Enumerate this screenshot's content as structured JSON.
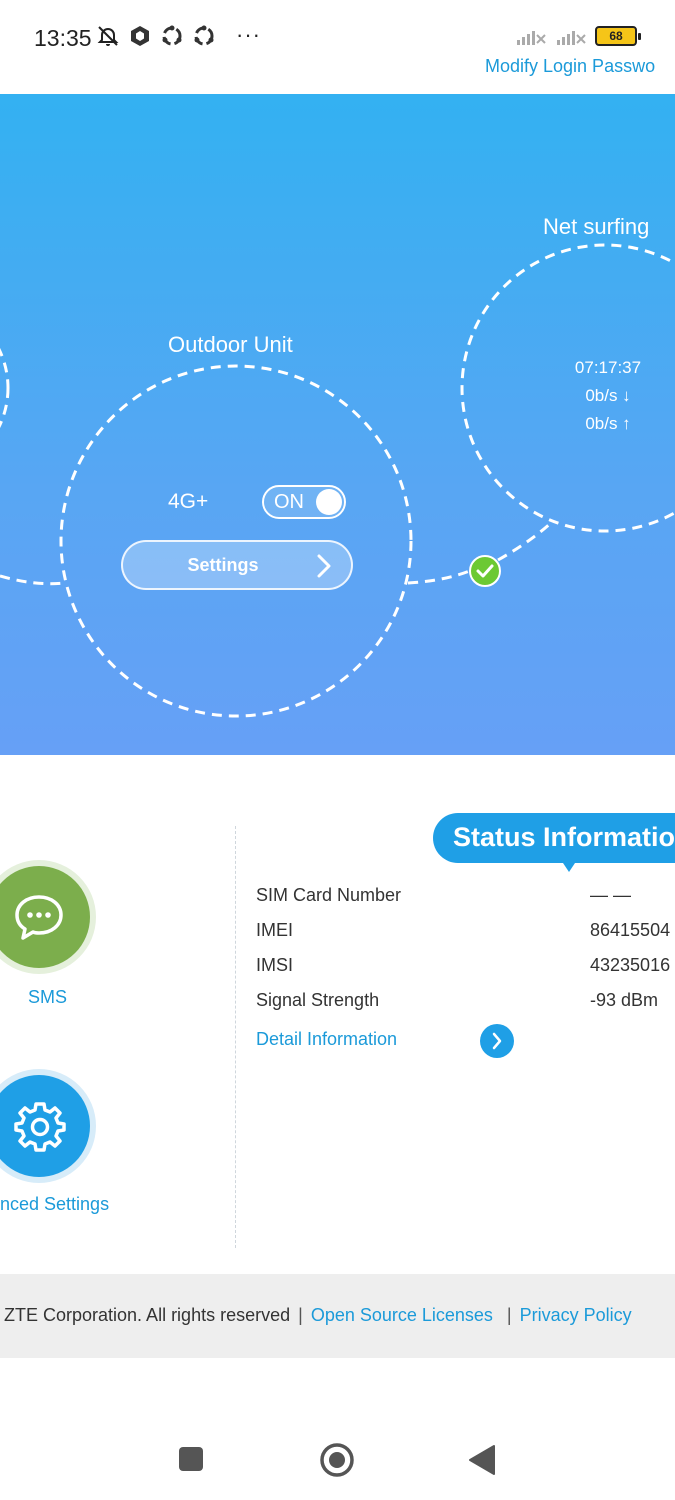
{
  "statusbar": {
    "time": "13:35",
    "battery": "68"
  },
  "header": {
    "modify_login_password": "Modify Login Passwo"
  },
  "hero": {
    "net_surfing_label": "Net surfing",
    "net_duration": "07:17:37",
    "download_rate": "0b/s ↓",
    "upload_rate": "0b/s ↑",
    "outdoor_unit_label": "Outdoor Unit",
    "network_type": "4G+",
    "toggle_label": "ON",
    "settings_label": "Settings"
  },
  "tiles": {
    "sms_label": "SMS",
    "advanced_label": "nced Settings"
  },
  "status": {
    "title": "Status Information",
    "rows": [
      {
        "label": "SIM Card Number",
        "value": "— —"
      },
      {
        "label": "IMEI",
        "value": "86415504"
      },
      {
        "label": "IMSI",
        "value": "43235016"
      },
      {
        "label": "Signal Strength",
        "value": "-93 dBm"
      }
    ],
    "detail_link": "Detail Information"
  },
  "footer": {
    "copyright": "ZTE Corporation. All rights reserved",
    "separator": "|",
    "open_source": "Open Source Licenses",
    "privacy": "Privacy Policy"
  },
  "colors": {
    "accent": "#1f9fe6",
    "sms_green": "#7cae4c",
    "hero_top": "#33b1f2",
    "hero_bottom": "#66a0f6"
  }
}
